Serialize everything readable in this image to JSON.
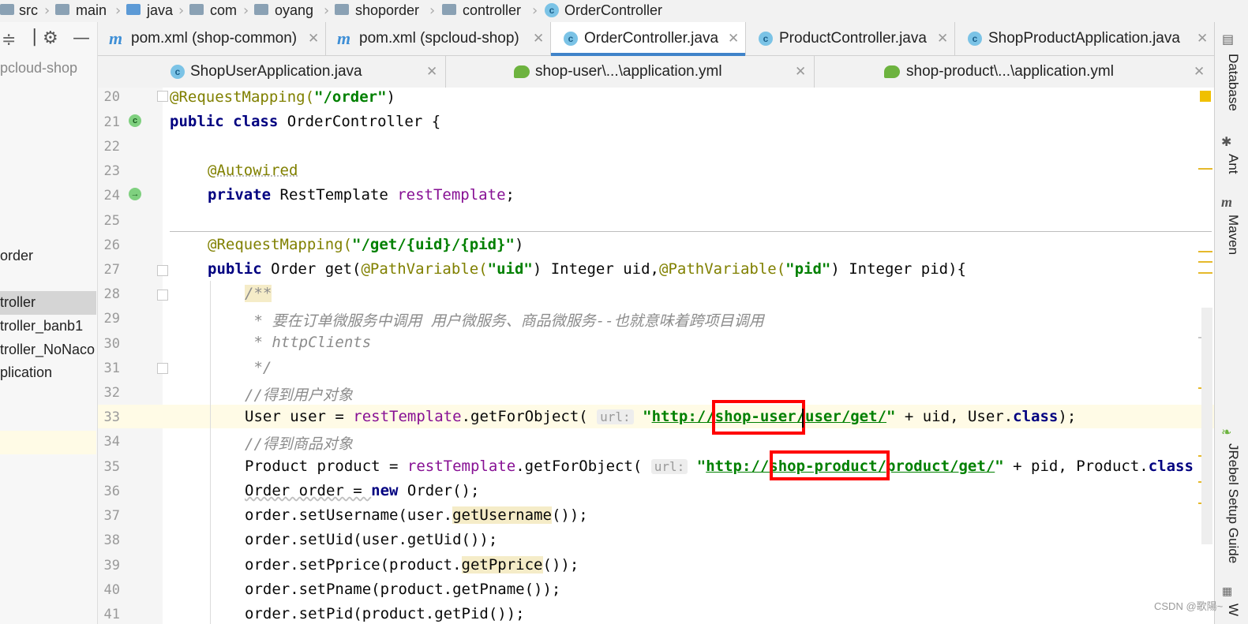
{
  "breadcrumb": {
    "items": [
      "src",
      "main",
      "java",
      "com",
      "oyang",
      "shoporder",
      "controller",
      "OrderController"
    ]
  },
  "project_panel": {
    "root": "pcloud-shop",
    "items": [
      "order",
      "troller",
      "troller_banb1",
      "troller_NoNaco",
      "plication"
    ]
  },
  "tabs_row1": [
    {
      "label": "pom.xml (shop-common)",
      "icon": "maven-icon"
    },
    {
      "label": "pom.xml (spcloud-shop)",
      "icon": "maven-icon"
    },
    {
      "label": "OrderController.java",
      "icon": "class-icon",
      "active": true
    },
    {
      "label": "ProductController.java",
      "icon": "class-icon"
    },
    {
      "label": "ShopProductApplication.java",
      "icon": "spring-app-icon"
    }
  ],
  "tabs_row2": [
    {
      "label": "ShopUserApplication.java",
      "icon": "spring-app-icon"
    },
    {
      "label": "shop-user\\...\\application.yml",
      "icon": "yaml-icon"
    },
    {
      "label": "shop-product\\...\\application.yml",
      "icon": "yaml-icon"
    }
  ],
  "close_glyph": "✕",
  "right_tools": [
    "Database",
    "Ant",
    "Maven",
    "JRebel Setup Guide",
    "W"
  ],
  "line_numbers": [
    "20",
    "21",
    "22",
    "23",
    "24",
    "25",
    "26",
    "27",
    "28",
    "29",
    "30",
    "31",
    "32",
    "33",
    "34",
    "35",
    "36",
    "37",
    "38",
    "39",
    "40",
    "41"
  ],
  "code": {
    "l20_ann": "@RequestMapping(",
    "l20_str": "\"/order\"",
    "l20_end": ")",
    "l21_kw": "public class",
    "l21_rest": " OrderController {",
    "l23_ann": "@Autowired",
    "l24_kw": "private",
    "l24_type": " RestTemplate ",
    "l24_field": "restTemplate",
    "l24_end": ";",
    "l26_ann": "@RequestMapping(",
    "l26_str": "\"/get/{uid}/{pid}\"",
    "l26_end": ")",
    "l27_kw": "public",
    "l27_a": " Order get(",
    "l27_ann1": "@PathVariable(",
    "l27_str1": "\"uid\"",
    "l27_b": ") Integer uid,",
    "l27_ann2": "@PathVariable(",
    "l27_str2": "\"pid\"",
    "l27_c": ") Integer pid){",
    "l28": "/**",
    "l29": " * 要在订单微服务中调用 用户微服务、商品微服务--也就意味着跨项目调用",
    "l30": " * httpClients",
    "l31": " */",
    "l32": "//得到用户对象",
    "l33_a": "User user = ",
    "l33_field": "restTemplate",
    "l33_b": ".getForObject( ",
    "l33_hint": "url:",
    "l33_q1": " \"",
    "l33_url": "http://shop-user/user/get/",
    "l33_q2": "\"",
    "l33_c": " + uid, User.",
    "l33_kw": "class",
    "l33_d": ");",
    "l34": "//得到商品对象",
    "l35_a": "Product product = ",
    "l35_field": "restTemplate",
    "l35_b": ".getForObject( ",
    "l35_hint": "url:",
    "l35_q1": " \"",
    "l35_url": "http://shop-product/product/get/",
    "l35_q2": "\"",
    "l35_c": " + pid, Product.",
    "l35_kw": "class",
    "l36_a": "Order order = ",
    "l36_kw": "new",
    "l36_b": " Order();",
    "l37_a": "order.setUsername(user.",
    "l37_usage": "getUsername",
    "l37_b": "());",
    "l38": "order.setUid(user.getUid());",
    "l39_a": "order.setPprice(product.",
    "l39_usage": "getPprice",
    "l39_b": "());",
    "l40": "order.setPname(product.getPname());",
    "l41": "order.setPid(product.getPid());"
  },
  "watermark": "CSDN @歌陽~",
  "colors": {
    "keyword": "#000080",
    "string": "#008000",
    "annotation": "#808000",
    "field": "#871094",
    "highlight_box": "#ff0000",
    "tab_underline": "#4083c9"
  }
}
